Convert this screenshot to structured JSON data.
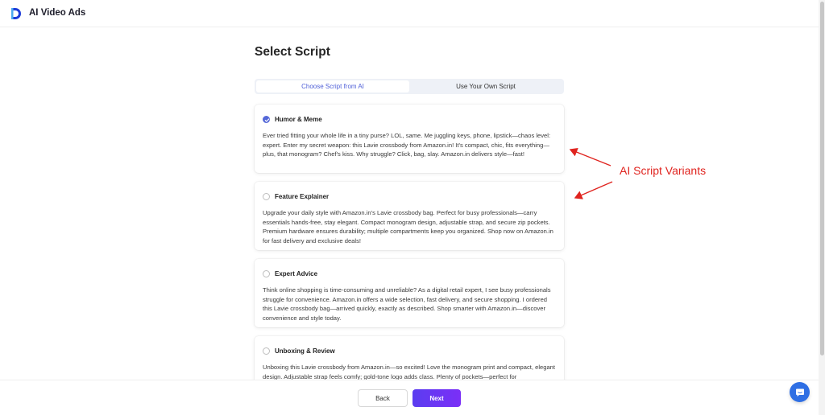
{
  "app": {
    "title": "AI Video Ads",
    "brand_color": "#2f6fe4"
  },
  "page": {
    "title": "Select Script"
  },
  "tabs": [
    {
      "label": "Choose Script from AI",
      "active": true
    },
    {
      "label": "Use Your Own Script",
      "active": false
    }
  ],
  "scripts": [
    {
      "title": "Humor & Meme",
      "selected": true,
      "text": "Ever tried fitting your whole life in a tiny purse? LOL, same. Me juggling keys, phone, lipstick—chaos level: expert. Enter my secret weapon: this Lavie crossbody from Amazon.in! It's compact, chic, fits everything—plus, that monogram? Chef's kiss. Why struggle? Click, bag, slay. Amazon.in delivers style—fast!"
    },
    {
      "title": "Feature Explainer",
      "selected": false,
      "text": "Upgrade your daily style with Amazon.in's Lavie crossbody bag. Perfect for busy professionals—carry essentials hands-free, stay elegant. Compact monogram design, adjustable strap, and secure zip pockets. Premium hardware ensures durability; multiple compartments keep you organized. Shop now on Amazon.in for fast delivery and exclusive deals!"
    },
    {
      "title": "Expert Advice",
      "selected": false,
      "text": "Think online shopping is time-consuming and unreliable? As a digital retail expert, I see busy professionals struggle for convenience. Amazon.in offers a wide selection, fast delivery, and secure shopping. I ordered this Lavie crossbody bag—arrived quickly, exactly as described. Shop smarter with Amazon.in—discover convenience and style today."
    },
    {
      "title": "Unboxing & Review",
      "selected": false,
      "text": "Unboxing this Lavie crossbody from Amazon.in—so excited! Love the monogram print and compact, elegant design. Adjustable strap feels comfy; gold-tone logo adds class. Plenty of pockets—perfect for"
    }
  ],
  "footer": {
    "back_label": "Back",
    "next_label": "Next"
  },
  "annotation": {
    "label": "AI Script Variants",
    "color": "#e0241f"
  },
  "icons": {
    "logo": "logo-icon",
    "check": "check-icon",
    "chat": "chat-icon"
  }
}
